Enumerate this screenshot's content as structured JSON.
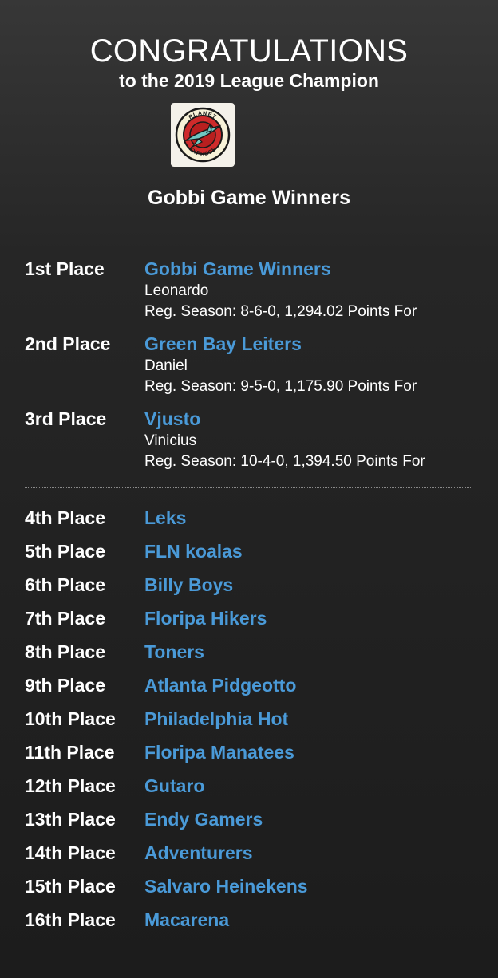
{
  "header": {
    "headline": "CONGRATULATIONS",
    "subheadline": "to the 2019 League Champion",
    "champion_name": "Gobbi Game Winners",
    "logo": {
      "icon": "planet-express-logo-icon",
      "ring_text": "PLANET EXPRESS"
    }
  },
  "podium": [
    {
      "place": "1st Place",
      "team": "Gobbi Game Winners",
      "owner": "Leonardo",
      "record": "Reg. Season: 8-6-0, 1,294.02 Points For"
    },
    {
      "place": "2nd Place",
      "team": "Green Bay Leiters",
      "owner": "Daniel",
      "record": "Reg. Season: 9-5-0, 1,175.90 Points For"
    },
    {
      "place": "3rd Place",
      "team": "Vjusto",
      "owner": "Vinicius",
      "record": "Reg. Season: 10-4-0, 1,394.50 Points For"
    }
  ],
  "others": [
    {
      "place": "4th Place",
      "team": "Leks"
    },
    {
      "place": "5th Place",
      "team": "FLN koalas"
    },
    {
      "place": "6th Place",
      "team": "Billy Boys"
    },
    {
      "place": "7th Place",
      "team": "Floripa Hikers"
    },
    {
      "place": "8th Place",
      "team": "Toners"
    },
    {
      "place": "9th Place",
      "team": "Atlanta Pidgeotto"
    },
    {
      "place": "10th Place",
      "team": "Philadelphia Hot"
    },
    {
      "place": "11th Place",
      "team": "Floripa Manatees"
    },
    {
      "place": "12th Place",
      "team": "Gutaro"
    },
    {
      "place": "13th Place",
      "team": "Endy Gamers"
    },
    {
      "place": "14th Place",
      "team": "Adventurers"
    },
    {
      "place": "15th Place",
      "team": "Salvaro Heinekens"
    },
    {
      "place": "16th Place",
      "team": "Macarena"
    }
  ],
  "colors": {
    "link": "#4a9ad8",
    "text": "#ffffff",
    "background_top": "#373737",
    "background_bottom": "#1c1c1c"
  }
}
